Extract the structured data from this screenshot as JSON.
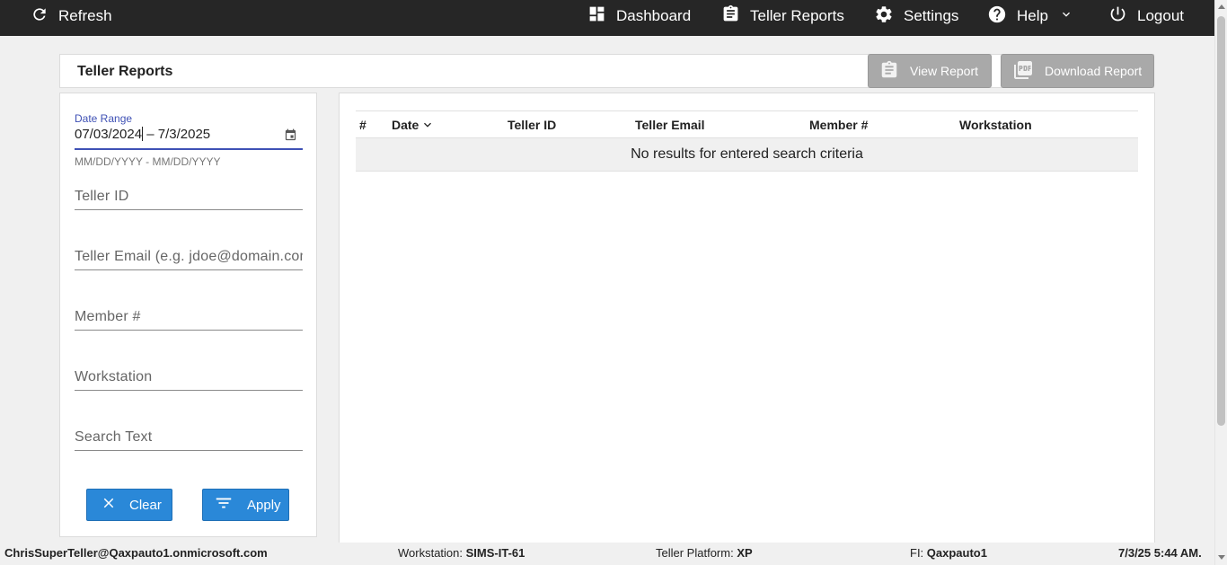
{
  "nav": {
    "refresh": "Refresh",
    "dashboard": "Dashboard",
    "teller_reports": "Teller Reports",
    "settings": "Settings",
    "help": "Help",
    "logout": "Logout"
  },
  "header": {
    "title": "Teller Reports",
    "view_report": "View Report",
    "download_report": "Download Report"
  },
  "filters": {
    "date_range_label": "Date Range",
    "date_start": "07/03/2024",
    "date_sep": " – ",
    "date_end": "7/3/2025",
    "date_hint": "MM/DD/YYYY - MM/DD/YYYY",
    "teller_id_placeholder": "Teller ID",
    "teller_email_placeholder": "Teller Email (e.g. jdoe@domain.com)",
    "member_placeholder": "Member #",
    "workstation_placeholder": "Workstation",
    "search_text_placeholder": "Search Text",
    "clear": "Clear",
    "apply": "Apply"
  },
  "table": {
    "columns": [
      "#",
      "Date",
      "Teller ID",
      "Teller Email",
      "Member #",
      "Workstation"
    ],
    "empty_message": "No results for entered search criteria"
  },
  "footer": {
    "user": "ChrisSuperTeller@Qaxpauto1.onmicrosoft.com",
    "workstation_label": "Workstation:",
    "workstation_value": "SIMS-IT-61",
    "platform_label": "Teller Platform:",
    "platform_value": "XP",
    "fi_label": "FI:",
    "fi_value": "Qaxpauto1",
    "timestamp": "7/3/25 5:44 AM."
  },
  "colors": {
    "topbar": "#262626",
    "primary_button": "#2a88d8",
    "disabled_button": "#a9a9a9",
    "focus_accent": "#3f51b5"
  }
}
